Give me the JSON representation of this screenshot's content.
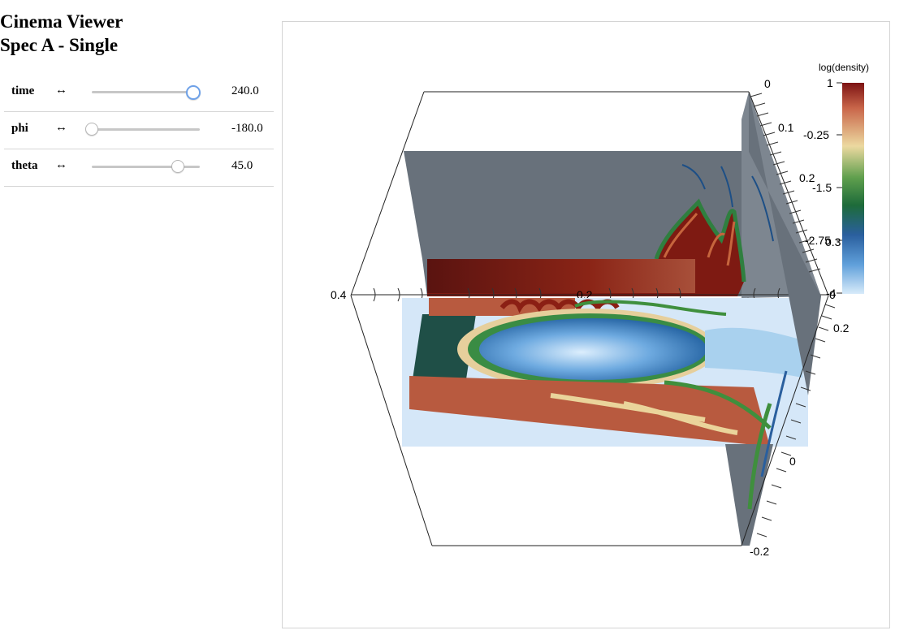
{
  "app": {
    "title_line1": "Cinema Viewer",
    "title_line2": "Spec A - Single"
  },
  "controls": [
    {
      "name": "time",
      "toggle_icon": "↔",
      "value_text": "240.0",
      "position": 0.93
    },
    {
      "name": "phi",
      "toggle_icon": "↔",
      "value_text": "-180.0",
      "position": 0.0
    },
    {
      "name": "theta",
      "toggle_icon": "↔",
      "value_text": "45.0",
      "position": 0.8
    }
  ],
  "viewer": {
    "colorbar": {
      "title": "log(density)",
      "tick_labels": [
        "1",
        "-0.25",
        "-1.5",
        "-2.75",
        "-4"
      ],
      "colors": [
        "#7d1313",
        "#c9664a",
        "#ecd9a0",
        "#5f9f4d",
        "#1d6b3a",
        "#2a5f9e",
        "#5f9fda",
        "#d8ebfa"
      ]
    },
    "axis_labels": {
      "horizontal": [
        "0.4",
        "0.2",
        "0"
      ],
      "right_upper": [
        "0",
        "0.1",
        "0.2",
        "0.3"
      ],
      "right_lower": [
        "0.2",
        "0",
        "-0.2"
      ]
    },
    "colors": {
      "slab_grey": "#68717b",
      "dark_red": "#7e1a12",
      "orange_red": "#b85a3f",
      "light_blue": "#d5e7f8",
      "mid_blue": "#3f86c8",
      "green": "#3f8f3d",
      "dark_teal": "#1f4f47",
      "cream": "#ead49b"
    }
  }
}
